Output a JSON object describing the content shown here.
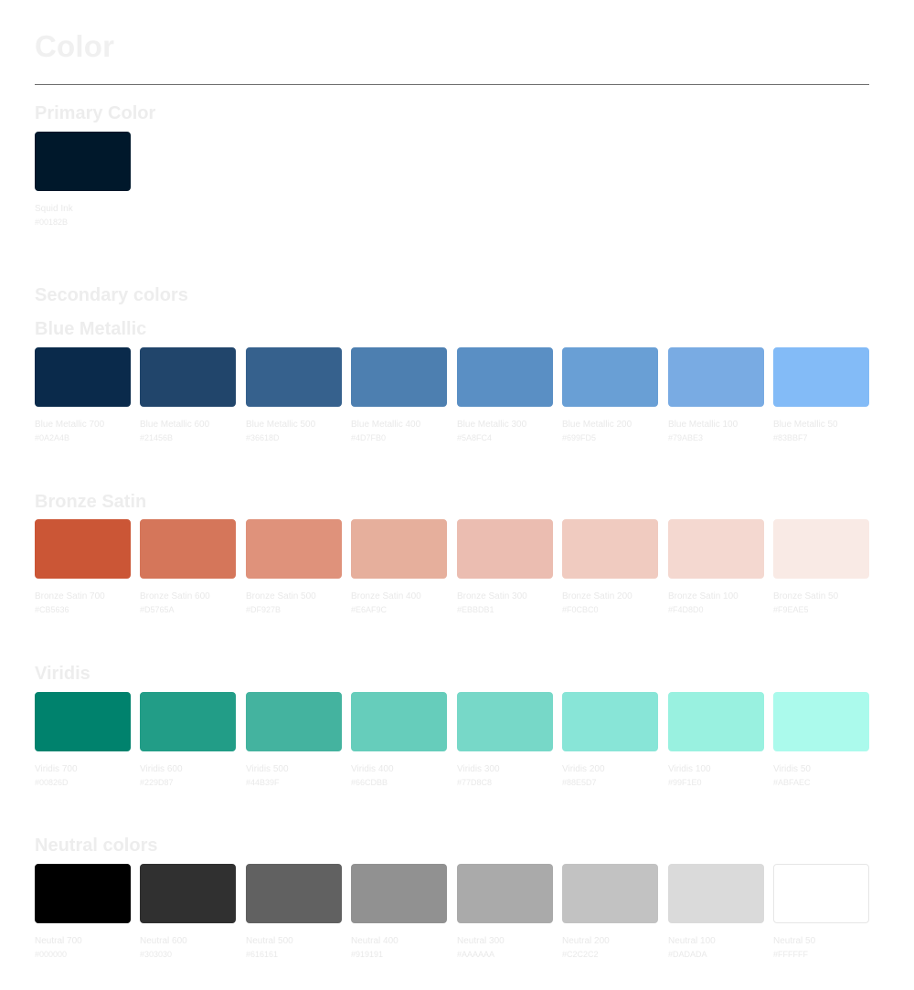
{
  "page": {
    "title": "Color"
  },
  "primary": {
    "heading": "Primary Color",
    "swatches": [
      {
        "name": "Squid Ink",
        "hex": "#00182B"
      }
    ]
  },
  "secondary": {
    "heading": "Secondary colors"
  },
  "blue_metallic": {
    "heading": "Blue Metallic",
    "swatches": [
      {
        "name": "Blue Metallic 700",
        "hex": "#0A2A4B"
      },
      {
        "name": "Blue Metallic 600",
        "hex": "#21456B"
      },
      {
        "name": "Blue Metallic 500",
        "hex": "#36618D"
      },
      {
        "name": "Blue Metallic 400",
        "hex": "#4D7FB0"
      },
      {
        "name": "Blue Metallic 300",
        "hex": "#5A8FC4"
      },
      {
        "name": "Blue Metallic 200",
        "hex": "#699FD5"
      },
      {
        "name": "Blue Metallic 100",
        "hex": "#79ABE3"
      },
      {
        "name": "Blue Metallic 50",
        "hex": "#83BBF7"
      }
    ]
  },
  "bronze_satin": {
    "heading": "Bronze Satin",
    "swatches": [
      {
        "name": "Bronze Satin 700",
        "hex": "#CB5636"
      },
      {
        "name": "Bronze Satin 600",
        "hex": "#D5765A"
      },
      {
        "name": "Bronze Satin 500",
        "hex": "#DF927B"
      },
      {
        "name": "Bronze Satin 400",
        "hex": "#E6AF9C"
      },
      {
        "name": "Bronze Satin 300",
        "hex": "#EBBDB1"
      },
      {
        "name": "Bronze Satin 200",
        "hex": "#F0CBC0"
      },
      {
        "name": "Bronze Satin 100",
        "hex": "#F4D8D0"
      },
      {
        "name": "Bronze Satin 50",
        "hex": "#F9EAE5"
      }
    ]
  },
  "viridis": {
    "heading": "Viridis",
    "swatches": [
      {
        "name": "Viridis 700",
        "hex": "#00826D"
      },
      {
        "name": "Viridis 600",
        "hex": "#229D87"
      },
      {
        "name": "Viridis 500",
        "hex": "#44B39F"
      },
      {
        "name": "Viridis 400",
        "hex": "#66CDBB"
      },
      {
        "name": "Viridis 300",
        "hex": "#77D8C8"
      },
      {
        "name": "Viridis 200",
        "hex": "#88E5D7"
      },
      {
        "name": "Viridis 100",
        "hex": "#99F1E0"
      },
      {
        "name": "Viridis 50",
        "hex": "#ABFAEC"
      }
    ]
  },
  "neutral": {
    "heading": "Neutral colors",
    "swatches": [
      {
        "name": "Neutral 700",
        "hex": "#000000"
      },
      {
        "name": "Neutral 600",
        "hex": "#303030"
      },
      {
        "name": "Neutral 500",
        "hex": "#616161"
      },
      {
        "name": "Neutral 400",
        "hex": "#919191"
      },
      {
        "name": "Neutral 300",
        "hex": "#AAAAAA"
      },
      {
        "name": "Neutral 200",
        "hex": "#C2C2C2"
      },
      {
        "name": "Neutral 100",
        "hex": "#DADADA"
      },
      {
        "name": "Neutral 50",
        "hex": "#FFFFFF"
      }
    ]
  }
}
